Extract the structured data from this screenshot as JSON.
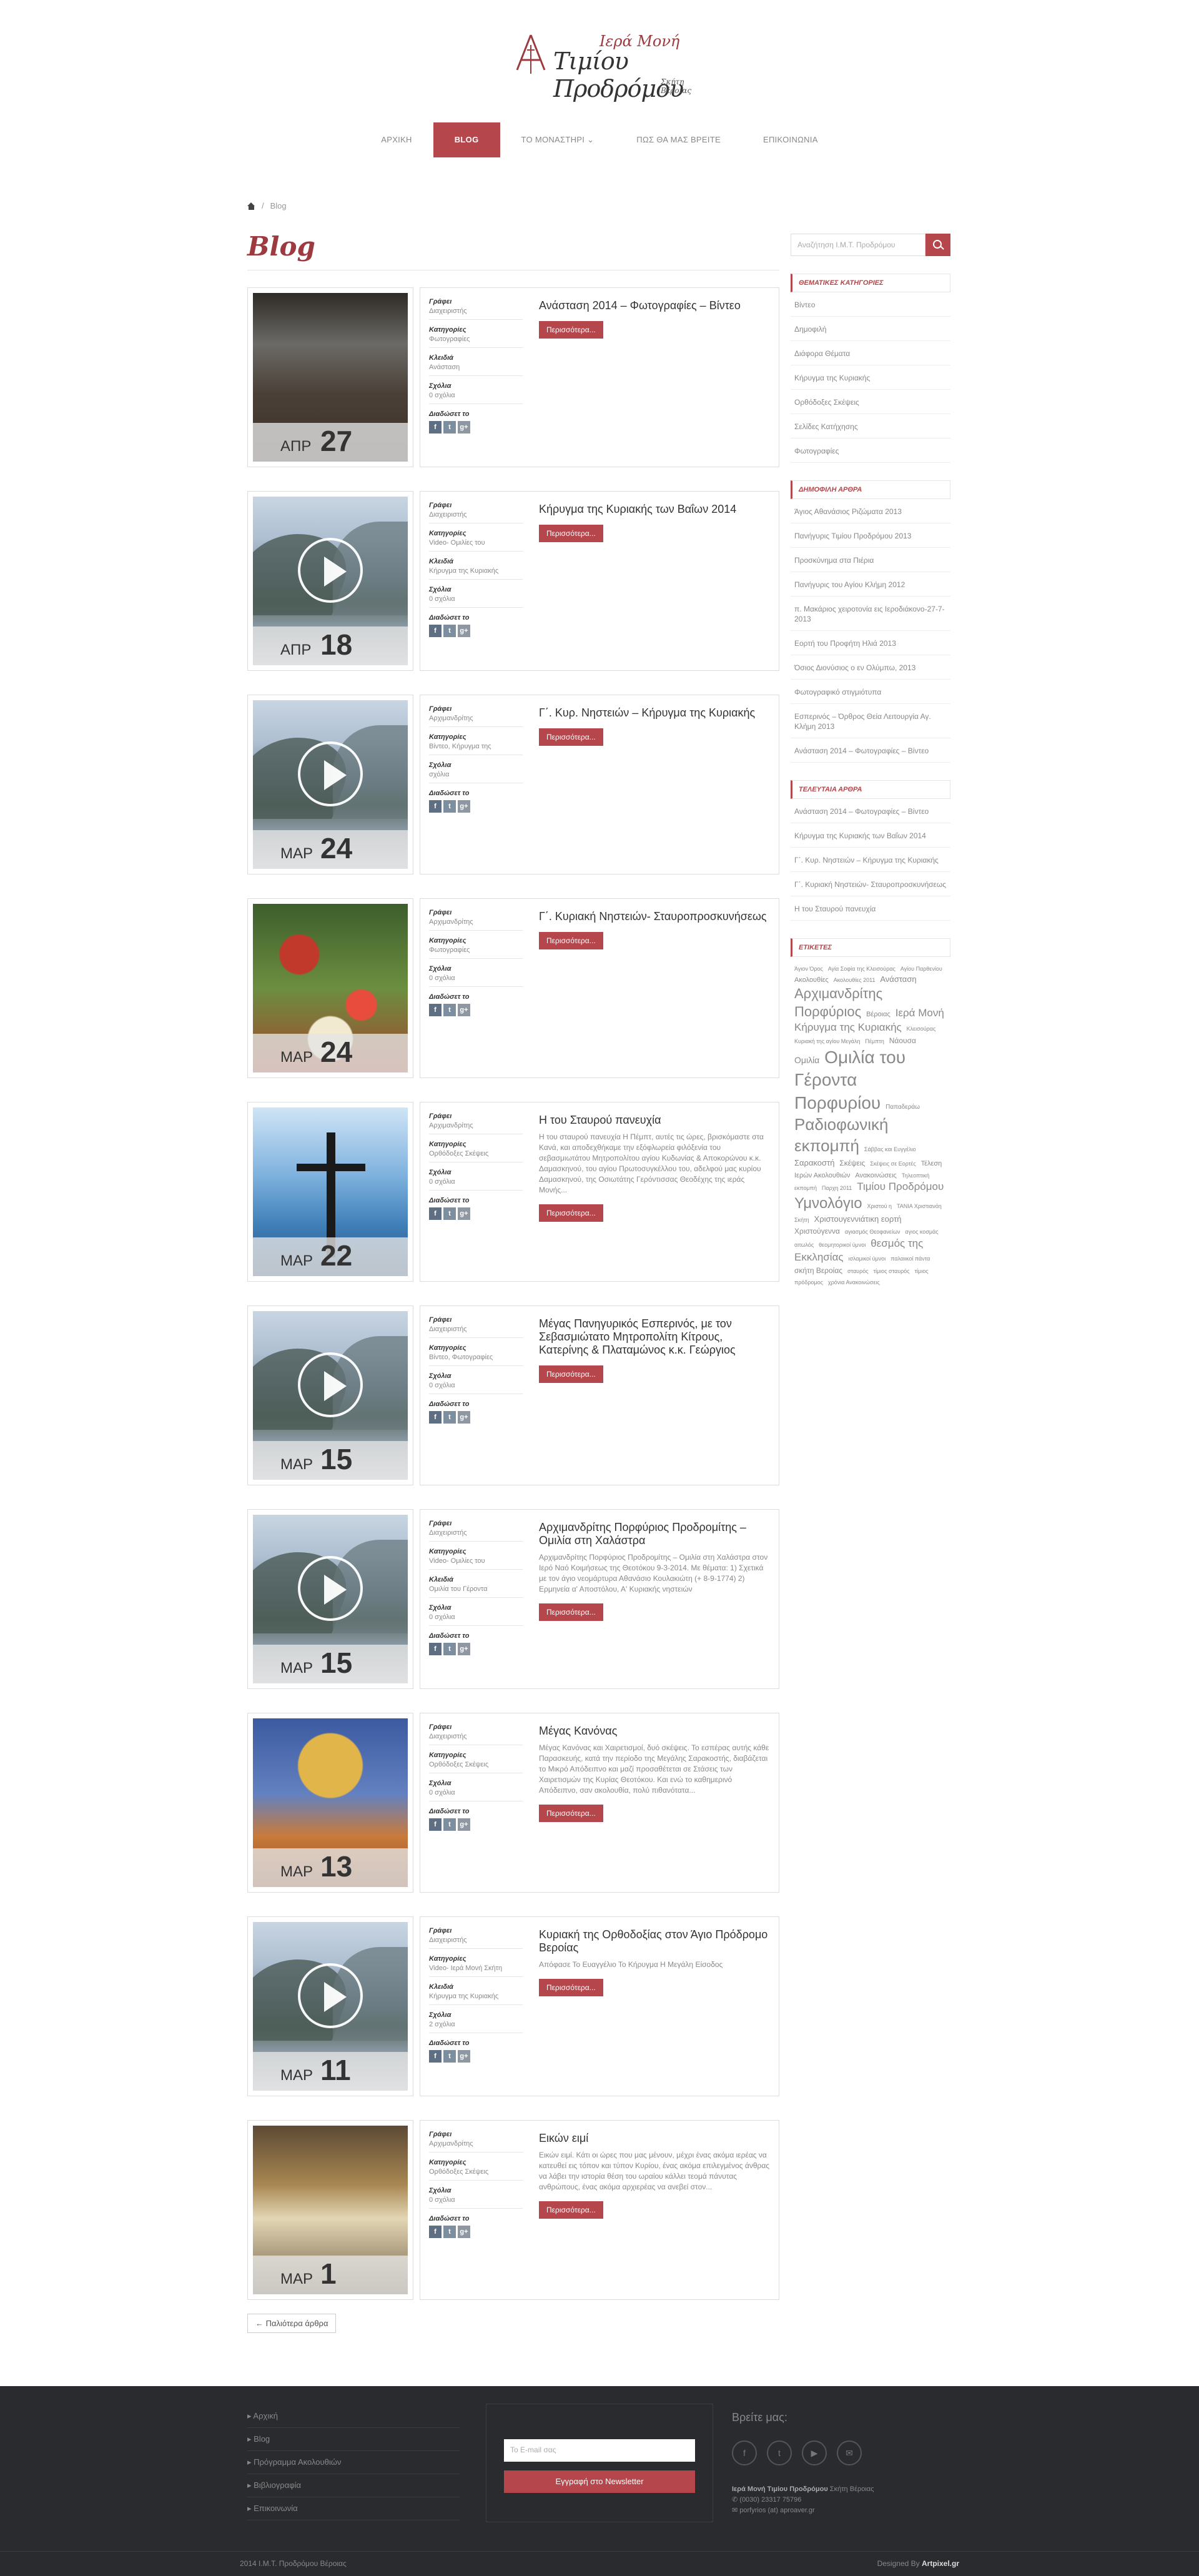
{
  "logo": {
    "line1": "Ιερά Μονή",
    "line2": "Τιμίου Προδρόμου",
    "line3": "Σκήτη Βέροιας"
  },
  "nav": [
    {
      "label": "ΑΡΧΙΚΗ"
    },
    {
      "label": "BLOG"
    },
    {
      "label": "ΤΟ ΜΟΝΑΣΤΗΡΙ ⌄"
    },
    {
      "label": "ΠΩΣ ΘΑ ΜΑΣ ΒΡΕΙΤΕ"
    },
    {
      "label": "ΕΠΙΚΟΙΝΩΝΙΑ"
    }
  ],
  "breadcrumb": {
    "current": "Blog"
  },
  "page_title": "Blog",
  "labels": {
    "author": "Γράφει",
    "category": "Κατηγορίες",
    "tags": "Κλειδιά",
    "comments": "Σχόλια",
    "share": "Διαδώσετ το",
    "more": "Περισσότερα..."
  },
  "posts": [
    {
      "month": "ΑΠΡ",
      "day": "27",
      "author": "Διαχειριστής",
      "category": "Φωτογραφίες",
      "tags": "Ανάσταση",
      "comments": "0 σχόλια",
      "title": "Ανάσταση 2014 – Φωτογραφίες – Βίντεο",
      "excerpt": ""
    },
    {
      "month": "ΑΠΡ",
      "day": "18",
      "author": "Διαχειριστής",
      "category": "Video- Ομιλίες του",
      "tags": "Κήρυγμα της Κυριακής",
      "comments": "0 σχόλια",
      "title": "Κήρυγμα της Κυριακής των Βαΐων 2014",
      "excerpt": ""
    },
    {
      "month": "ΜΑΡ",
      "day": "24",
      "author": "Αρχιμανδρίτης",
      "category": "Βίντεο, Κήρυγμα της",
      "tags": "",
      "comments": "σχόλια",
      "title": "Γ΄. Κυρ. Νηστειών – Κήρυγμα της Κυριακής",
      "excerpt": ""
    },
    {
      "month": "ΜΑΡ",
      "day": "24",
      "author": "Αρχιμανδρίτης",
      "category": "Φωτογραφίες",
      "tags": "",
      "comments": "0 σχόλια",
      "title": "Γ΄. Κυριακή Νηστειών- Σταυροπροσκυνήσεως",
      "excerpt": ""
    },
    {
      "month": "ΜΑΡ",
      "day": "22",
      "author": "Αρχιμανδρίτης",
      "category": "Ορθόδοξες Σκέψεις",
      "tags": "",
      "comments": "0 σχόλια",
      "title": "Η του Σταυρού πανευχία",
      "excerpt": "Η του σταυρού πανευχία Η Πέμπτ, αυτές τις ώρες, βρισκόμαστε στα Κανά, και αποδεχθήκαμε την εξόφλωρεία φιλόξενία του σεβασμιωτάτου Μητροπολίτου αγίου Κυδωνίας & Αποκορώνου κ.κ. Δαμασκηνού, του αγίου Πρωτοσυγκέλλου του, αδελφού μας κυρίου Δαμασκηνού, της Οσιωτάτης Γερόντισσας Θεοδέχης της ιεράς Μονής..."
    },
    {
      "month": "ΜΑΡ",
      "day": "15",
      "author": "Διαχειριστής",
      "category": "Βίντεο, Φωτογραφίες",
      "tags": "",
      "comments": "0 σχόλια",
      "title": "Μέγας Πανηγυρικός Εσπερινός, με τον Σεβασμιώτατο Μητροπολίτη Κίτρους, Κατερίνης & Πλαταμώνος κ.κ. Γεώργιος",
      "excerpt": ""
    },
    {
      "month": "ΜΑΡ",
      "day": "15",
      "author": "Διαχειριστής",
      "category": "Video- Ομιλίες του",
      "tags": "Ομιλία του Γέροντα",
      "comments": "0 σχόλια",
      "title": "Αρχιμανδρίτης Πορφύριος Προδρομίτης – Ομιλία στη Χαλάστρα",
      "excerpt": "Αρχιμανδρίτης Πορφύριος Προδρομίτης – Ομιλία στη Χαλάστρα στον Ιερό Ναό Κοιμήσεως της Θεοτόκου 9-3-2014. Με θέματα: 1) Σχετικά με τον άγιο νεομάρτυρα Αθανάσιο Κουλακιώτη (+ 8-9-1774) 2) Ερμηνεία α' Αποστόλου, Α' Κυριακής νηστειών"
    },
    {
      "month": "ΜΑΡ",
      "day": "13",
      "author": "Διαχειριστής",
      "category": "Ορθόδοξες Σκέψεις",
      "tags": "",
      "comments": "0 σχόλια",
      "title": "Μέγας Κανόνας",
      "excerpt": "Μέγας Κανόνας και Χαιρετισμοί, δυό σκέψεις. Το εσπέρας αυτής κάθε Παρασκευής, κατά την περίοδο της Μεγάλης Σαρακοστής, διαβάζεται το Μικρό Απόδειπνο και μαζί προσαθέτεται σε Στάσεις των Χαιρετισμών της Κυρίας Θεοτόκου. Και ενώ το καθημερινό Απόδειπνο, σαν ακολουθία, πολύ πιθανότατα..."
    },
    {
      "month": "ΜΑΡ",
      "day": "11",
      "author": "Διαχειριστής",
      "category": "Video- Ιερά Μονή Σκήτη",
      "tags": "Κήρυγμα της Κυριακής",
      "comments": "2 σχόλια",
      "title": "Κυριακή της Ορθοδοξίας στον Άγιο Πρόδρομο Βεροίας",
      "excerpt": "Απόφασε Το Ευαγγέλιο Το Κήρυγμα Η Μεγάλη Είσοδος"
    },
    {
      "month": "ΜΑΡ",
      "day": "1",
      "author": "Αρχιμανδρίτης",
      "category": "Ορθόδοξες Σκέψεις",
      "tags": "",
      "comments": "0 σχόλια",
      "title": "Εικών ειμί",
      "excerpt": "Εικών ειμί. Κάτι οι ώρες που μας μένουν, μέχρι ένας ακόμα ιερέας να κατευθεί εις τόπον και τύπον Κυρίου, ένας ακόμα επιλεγμένος άνθρας να λάβει την ιστορία θέση του ωραίου κάλλει τεομά πάνυτας ανθρώπους, ένας ακόμα αρχιερέας να ανεβεί στον..."
    }
  ],
  "older_label": "← Παλιότερα άρθρα",
  "sidebar": {
    "search_placeholder": "Αναζήτηση Ι.Μ.Τ. Προδρόμου",
    "categories_title": "ΘΕΜΑΤΙΚΕΣ ΚΑΤΗΓΟΡΙΕΣ",
    "categories": [
      "Βίντεο",
      "Δημοφιλή",
      "Διάφορα Θέματα",
      "Κήρυγμα της Κυριακής",
      "Ορθόδοξες Σκέψεις",
      "Σελίδες Κατήχησης",
      "Φωτογραφίες"
    ],
    "popular_title": "ΔΗΜΟΦΙΛΗ ΑΡΘΡΑ",
    "popular": [
      "Άγιος Αθανάσιος Ριζώματα 2013",
      "Πανήγυρις Τιμίου Προδρόμου 2013",
      "Προσκύνημα στα Πιέρια",
      "Πανήγυρις του Αγίου Κλήμη 2012",
      "π. Μακάριος χειροτονία εις Ιεροδιάκονο-27-7-2013",
      "Εορτή του Προφήτη Ηλιά 2013",
      "Όσιος Διονύσιος ο εν Ολύμπω, 2013",
      "Φωτογραφικό στιγμιότυπα",
      "Εσπερινός – Όρθρος Θεία Λειτουργία Αγ. Κλήμη 2013",
      "Ανάσταση 2014 – Φωτογραφίες – Βίντεο"
    ],
    "recent_title": "ΤΕΛΕΥΤΑΙΑ ΑΡΘΡΑ",
    "recent": [
      "Ανάσταση 2014 – Φωτογραφίες – Βίντεο",
      "Κήρυγμα της Κυριακής των Βαΐων 2014",
      "Γ΄. Κυρ. Νηστειών – Κήρυγμα της Κυριακής",
      "Γ΄. Κυριακή Νηστειών- Σταυροπροσκυνήσεως",
      "Η του Σταυρού πανευχία"
    ],
    "tags_title": "ΕΤΙΚΕΤΕΣ",
    "tags": [
      {
        "text": "Άγιον Όρος",
        "size": 9
      },
      {
        "text": "Αγία Σοφία της Κλεισούρας",
        "size": 9
      },
      {
        "text": "Αγίου Παρθενίου",
        "size": 9
      },
      {
        "text": "Ακολουθίες",
        "size": 11
      },
      {
        "text": "Ακολουθίες 2011",
        "size": 9
      },
      {
        "text": "Ανάσταση",
        "size": 13
      },
      {
        "text": "Αρχιμανδρίτης Πορφύριος",
        "size": 22
      },
      {
        "text": "Βέροιας",
        "size": 11
      },
      {
        "text": "Ιερά Μονή",
        "size": 17
      },
      {
        "text": "Κήρυγμα της Κυριακής",
        "size": 17
      },
      {
        "text": "Κλεισούρας",
        "size": 9
      },
      {
        "text": "Κυριακή της αγίου Μεγάλη",
        "size": 9
      },
      {
        "text": "Πέμπτη",
        "size": 9
      },
      {
        "text": "Νάουσα",
        "size": 12
      },
      {
        "text": "Ομιλία",
        "size": 14
      },
      {
        "text": "Ομιλία του Γέροντα Πορφυρίου",
        "size": 28
      },
      {
        "text": "Παπαδεράω",
        "size": 10
      },
      {
        "text": "Ραδιοφωνική εκπομπή",
        "size": 26
      },
      {
        "text": "Σάββας και Ευγγέλιο",
        "size": 9
      },
      {
        "text": "Σαρακοστή",
        "size": 13
      },
      {
        "text": "Σκέψεις",
        "size": 12
      },
      {
        "text": "Σκέψεις σε Εορτές",
        "size": 9
      },
      {
        "text": "Τέλεση Ιερών Ακολουθιών",
        "size": 11
      },
      {
        "text": "Ανακοινώσεις",
        "size": 11
      },
      {
        "text": "Τηλεοπτική εκπομπή",
        "size": 9
      },
      {
        "text": "Παρχη 2011",
        "size": 9
      },
      {
        "text": "Τιμίου Προδρόμου",
        "size": 17
      },
      {
        "text": "Υμνολόγιο",
        "size": 24
      },
      {
        "text": "Χριστού η",
        "size": 9
      },
      {
        "text": "ΤΑΝΙΑ Χριστιανόη Σκήτη",
        "size": 9
      },
      {
        "text": "Χριστουγεννιάτικη εορτή",
        "size": 13
      },
      {
        "text": "Χριστούγεννα",
        "size": 12
      },
      {
        "text": "αγιασμός Θεοφανείων",
        "size": 9
      },
      {
        "text": "αγιος κοσμάς αιτωλός",
        "size": 9
      },
      {
        "text": "θεομητορικοί ύμνοι",
        "size": 9
      },
      {
        "text": "θεσμός της Εκκλησίας",
        "size": 17
      },
      {
        "text": "ισλαμικοί ύμνοι",
        "size": 9
      },
      {
        "text": "παλαιικοί πάντα",
        "size": 9
      },
      {
        "text": "σκήτη Βεροίας",
        "size": 12
      },
      {
        "text": "σταυρός",
        "size": 9
      },
      {
        "text": "τίμιος σταυρός",
        "size": 9
      },
      {
        "text": "τίμιος πρόδρομος",
        "size": 9
      },
      {
        "text": "χρόνια Ανακοινώσεις",
        "size": 9
      }
    ]
  },
  "footer": {
    "menu": [
      "Αρχική",
      "Blog",
      "Πρόγραμμα Ακολουθιών",
      "Βιβλιογραφία",
      "Επικοινωνία"
    ],
    "newsletter_placeholder": "Το E-mail σας",
    "newsletter_button": "Εγγραφή στο Newsletter",
    "follow_title": "Βρείτε μας:",
    "socials": [
      "f",
      "t",
      "▶",
      "✉"
    ],
    "address_name": "Ιερά Μονή Τιμίου Προδρόμου",
    "address_place": "Σκήτη Βέροιας",
    "phone": "(0030) 23317 75796",
    "email": "porfyrios (at) aproaver.gr",
    "copyright": "2014 Ι.Μ.Τ. Προδρόμου Βέροιας",
    "designed_by_label": "Designed By",
    "designed_by": "Artpixel.gr"
  },
  "colors": {
    "accent": "#b5464b",
    "footer_bg": "#2a2b2e"
  }
}
